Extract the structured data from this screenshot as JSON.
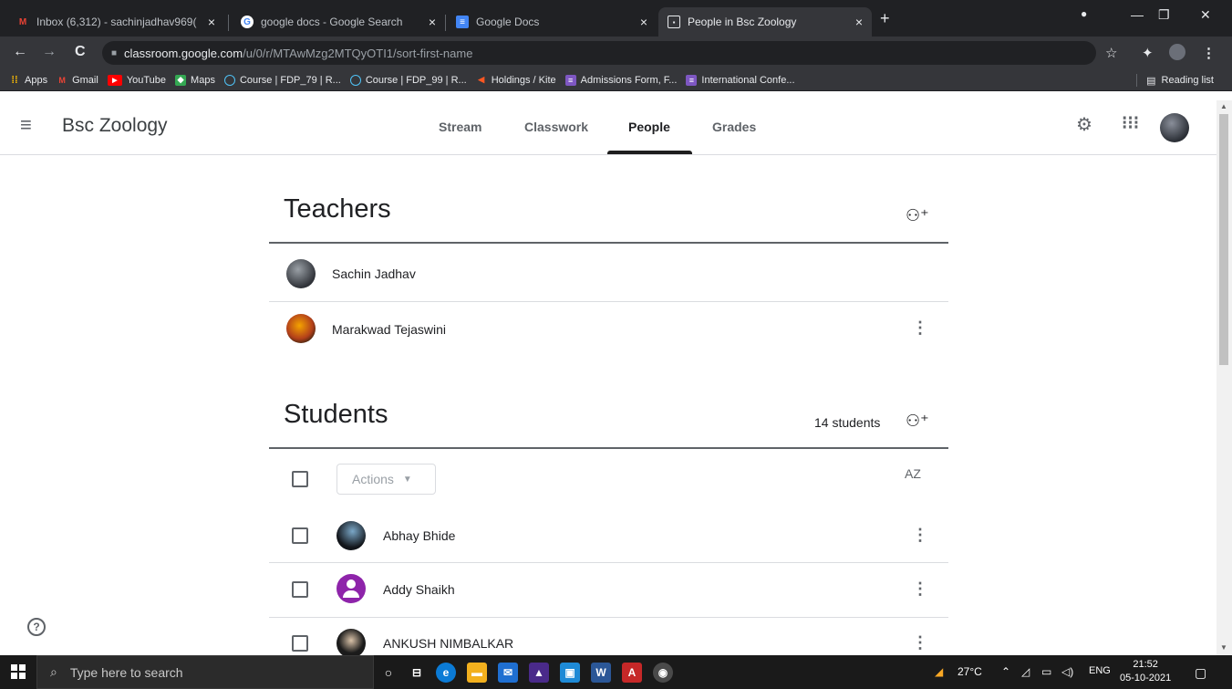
{
  "browser": {
    "tabs": [
      {
        "title": "Inbox (6,312) - sachinjadhav969(",
        "icon": "gmail-icon"
      },
      {
        "title": "google docs - Google Search",
        "icon": "google-icon"
      },
      {
        "title": "Google Docs",
        "icon": "docs-icon"
      },
      {
        "title": "People in Bsc Zoology",
        "icon": "classroom-icon",
        "active": true
      }
    ],
    "url_host": "classroom.google.com",
    "url_path": "/u/0/r/MTAwMzg2MTQyOTI1/sort-first-name",
    "bookmarks": [
      {
        "label": "Apps",
        "icon": "apps-grid-icon"
      },
      {
        "label": "Gmail",
        "icon": "gmail-icon"
      },
      {
        "label": "YouTube",
        "icon": "youtube-icon"
      },
      {
        "label": "Maps",
        "icon": "maps-icon"
      },
      {
        "label": "Course | FDP_79 | R...",
        "icon": "globe-icon"
      },
      {
        "label": "Course | FDP_99 | R...",
        "icon": "globe-icon"
      },
      {
        "label": "Holdings / Kite",
        "icon": "kite-icon"
      },
      {
        "label": "Admissions Form, F...",
        "icon": "forms-icon"
      },
      {
        "label": "International Confe...",
        "icon": "forms-icon"
      }
    ],
    "reading_list": "Reading list"
  },
  "classroom": {
    "course_title": "Bsc Zoology",
    "nav": {
      "stream": "Stream",
      "classwork": "Classwork",
      "people": "People",
      "grades": "Grades"
    },
    "teachers_heading": "Teachers",
    "teachers": [
      "Sachin Jadhav",
      "Marakwad Tejaswini"
    ],
    "students_heading": "Students",
    "student_count": "14 students",
    "actions_label": "Actions",
    "sort_label": "AZ",
    "students": [
      "Abhay Bhide",
      "Addy Shaikh",
      "ANKUSH NIMBALKAR"
    ]
  },
  "taskbar": {
    "search_placeholder": "Type here to search",
    "temperature": "27°C",
    "language": "ENG",
    "time": "21:52",
    "date": "05-10-2021"
  },
  "colors": {
    "chrome_dark": "#202124",
    "chrome_toolbar": "#35363a",
    "accent_purple": "#8e24aa"
  }
}
